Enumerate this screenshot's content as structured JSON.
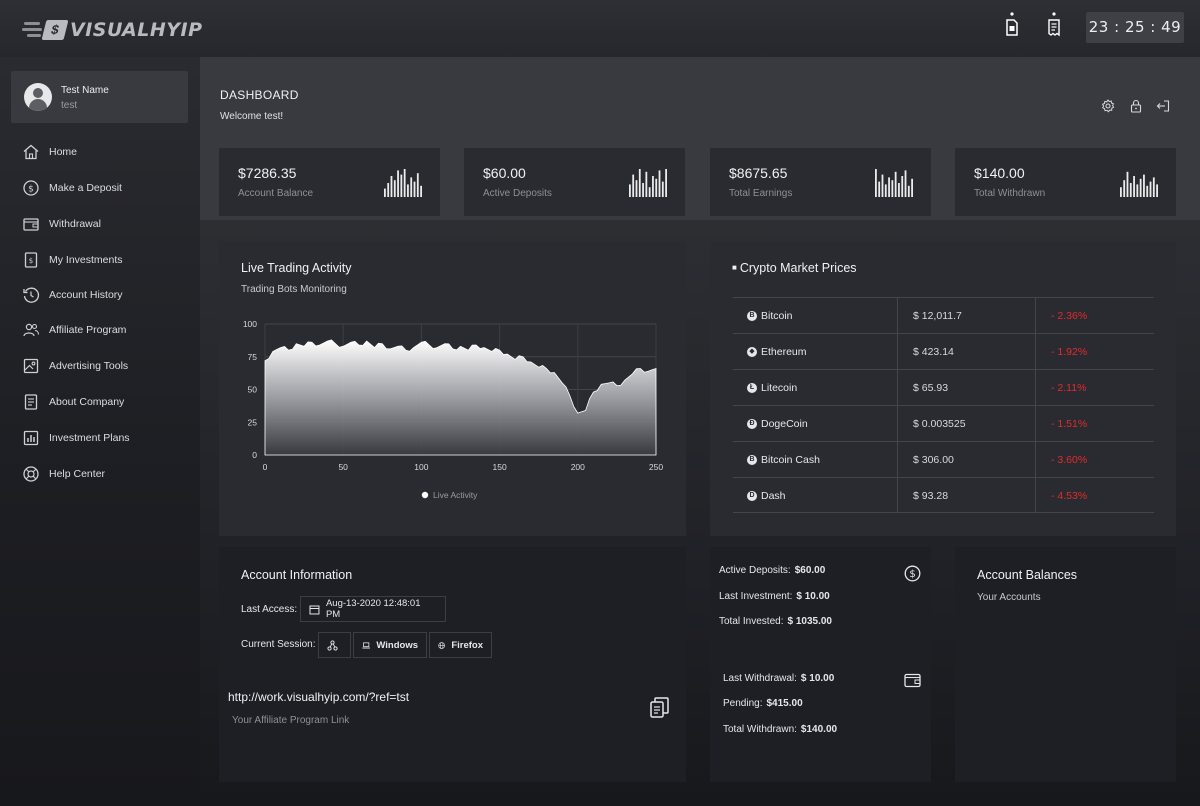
{
  "brand": {
    "name": "VISUALHYIP",
    "logo_tag": "$"
  },
  "header": {
    "clock": "23 : 25 : 49",
    "icons": [
      "sim-card-icon",
      "receipt-icon"
    ]
  },
  "user": {
    "name": "Test Name",
    "username": "test"
  },
  "sidebar": {
    "items": [
      {
        "label": "Home",
        "icon": "home-icon"
      },
      {
        "label": "Make a Deposit",
        "icon": "dollar-coin-icon"
      },
      {
        "label": "Withdrawal",
        "icon": "wallet-icon"
      },
      {
        "label": "My Investments",
        "icon": "document-icon"
      },
      {
        "label": "Account History",
        "icon": "history-icon"
      },
      {
        "label": "Affiliate Program",
        "icon": "users-icon"
      },
      {
        "label": "Advertising Tools",
        "icon": "image-icon"
      },
      {
        "label": "About Company",
        "icon": "info-doc-icon"
      },
      {
        "label": "Investment Plans",
        "icon": "chart-icon"
      },
      {
        "label": "Help Center",
        "icon": "lifebuoy-icon"
      }
    ]
  },
  "dashboard": {
    "title": "DASHBOARD",
    "welcome": "Welcome test!",
    "actions": [
      "settings-icon",
      "lock-icon",
      "logout-icon"
    ]
  },
  "stats": [
    {
      "value": "$7286.35",
      "label": "Account Balance",
      "bars": [
        0.3,
        0.5,
        0.75,
        0.6,
        0.95,
        0.8,
        1.0,
        0.45,
        0.7,
        0.55,
        0.85,
        0.4
      ]
    },
    {
      "value": "$60.00",
      "label": "Active Deposits",
      "bars": [
        0.45,
        0.8,
        0.6,
        1.0,
        0.5,
        0.9,
        0.35,
        0.75,
        0.65,
        0.95,
        0.55,
        1.0
      ]
    },
    {
      "value": "$8675.65",
      "label": "Total Earnings",
      "bars": [
        1.0,
        0.55,
        0.8,
        0.45,
        0.7,
        0.6,
        0.9,
        0.5,
        0.75,
        0.95,
        0.4,
        0.65
      ]
    },
    {
      "value": "$140.00",
      "label": "Total Withdrawn",
      "bars": [
        0.35,
        0.6,
        0.9,
        0.5,
        0.75,
        0.45,
        0.65,
        0.8,
        0.4,
        0.55,
        0.7,
        0.45
      ]
    }
  ],
  "live_trading": {
    "title": "Live Trading Activity",
    "subtitle": "Trading Bots Monitoring",
    "legend": "Live Activity"
  },
  "chart_data": {
    "type": "area",
    "title": "Live Trading Activity",
    "subtitle": "Trading Bots Monitoring",
    "xlim": [
      0,
      250
    ],
    "ylim": [
      0,
      100
    ],
    "xticks": [
      0,
      50,
      100,
      150,
      200,
      250
    ],
    "yticks": [
      0,
      25,
      50,
      75,
      100
    ],
    "series": [
      {
        "name": "Live Activity",
        "x": [
          0,
          5,
          10,
          15,
          20,
          25,
          30,
          35,
          40,
          45,
          50,
          55,
          60,
          65,
          70,
          75,
          80,
          85,
          90,
          95,
          100,
          105,
          110,
          115,
          120,
          125,
          130,
          135,
          140,
          145,
          150,
          155,
          160,
          165,
          170,
          175,
          180,
          185,
          190,
          195,
          200,
          205,
          210,
          215,
          220,
          225,
          230,
          235,
          240,
          245,
          250
        ],
        "y": [
          72,
          79,
          82,
          80,
          85,
          83,
          86,
          84,
          87,
          85,
          83,
          86,
          84,
          87,
          82,
          85,
          81,
          83,
          80,
          82,
          86,
          84,
          82,
          85,
          81,
          83,
          80,
          84,
          82,
          79,
          80,
          77,
          73,
          75,
          71,
          67,
          66,
          63,
          55,
          45,
          32,
          34,
          48,
          54,
          55,
          53,
          57,
          62,
          66,
          64,
          66
        ]
      }
    ]
  },
  "crypto": {
    "title": "Crypto Market Prices",
    "rows": [
      {
        "name": "Bitcoin",
        "price": "$ 12,011.7",
        "change": "- 2.36%",
        "icon": "bitcoin-icon",
        "glyph": "B"
      },
      {
        "name": "Ethereum",
        "price": "$ 423.14",
        "change": "- 1.92%",
        "icon": "ethereum-icon",
        "glyph": "◆"
      },
      {
        "name": "Litecoin",
        "price": "$ 65.93",
        "change": "- 2.11%",
        "icon": "litecoin-icon",
        "glyph": "Ł"
      },
      {
        "name": "DogeCoin",
        "price": "$ 0.003525",
        "change": "- 1.51%",
        "icon": "dogecoin-icon",
        "glyph": "Ð"
      },
      {
        "name": "Bitcoin Cash",
        "price": "$ 306.00",
        "change": "- 3.60%",
        "icon": "bitcoin-cash-icon",
        "glyph": "B"
      },
      {
        "name": "Dash",
        "price": "$ 93.28",
        "change": "- 4.53%",
        "icon": "dash-icon",
        "glyph": "D"
      }
    ]
  },
  "account_info": {
    "title": "Account Information",
    "last_access_label": "Last Access:",
    "last_access_value": "Aug-13-2020 12:48:01 PM",
    "session_label": "Current Session:",
    "os": "Windows",
    "browser": "Firefox",
    "ref_link": "http://work.visualhyip.com/?ref=tst",
    "ref_link_label": "Your Affiliate Program Link"
  },
  "deposits_summary": {
    "active_deposits_label": "Active Deposits:",
    "active_deposits": "$60.00",
    "last_investment_label": "Last Investment:",
    "last_investment": "$ 10.00",
    "total_invested_label": "Total Invested:",
    "total_invested": "$ 1035.00",
    "last_withdrawal_label": "Last Withdrawal:",
    "last_withdrawal": "$ 10.00",
    "pending_label": "Pending:",
    "pending": "$415.00",
    "total_withdrawn_label": "Total Withdrawn:",
    "total_withdrawn": "$140.00"
  },
  "balances": {
    "title": "Account Balances",
    "subtitle": "Your Accounts"
  },
  "colors": {
    "negative": "#e22b2b",
    "panel": "#2a2b30",
    "header_panel": "#393a40"
  }
}
